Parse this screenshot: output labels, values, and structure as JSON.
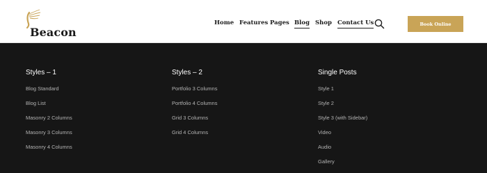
{
  "header": {
    "logo_text": "Beacon",
    "nav": [
      {
        "label": "Home"
      },
      {
        "label": "Features"
      },
      {
        "label": "Pages"
      },
      {
        "label": "Blog"
      },
      {
        "label": "Shop"
      },
      {
        "label": "Contact Us"
      }
    ],
    "search_icon": "search-icon",
    "book_button": "Book Online",
    "accent_color": "#c9a457"
  },
  "menu": {
    "columns": [
      {
        "title": "Styles – 1",
        "items": [
          "Blog Standard",
          "Blog List",
          "Masonry 2 Columns",
          "Masonry 3 Columns",
          "Masonry 4 Columns"
        ]
      },
      {
        "title": "Styles – 2",
        "items": [
          "Portfolio 3 Columns",
          "Portfolio 4 Columns",
          "Grid 3 Columns",
          "Grid 4 Columns"
        ]
      },
      {
        "title": "Single Posts",
        "items": [
          "Style 1",
          "Style 2",
          "Style 3 (with Sidebar)",
          "Video",
          "Audio",
          "Gallery"
        ]
      }
    ],
    "background_color": "#161616"
  }
}
